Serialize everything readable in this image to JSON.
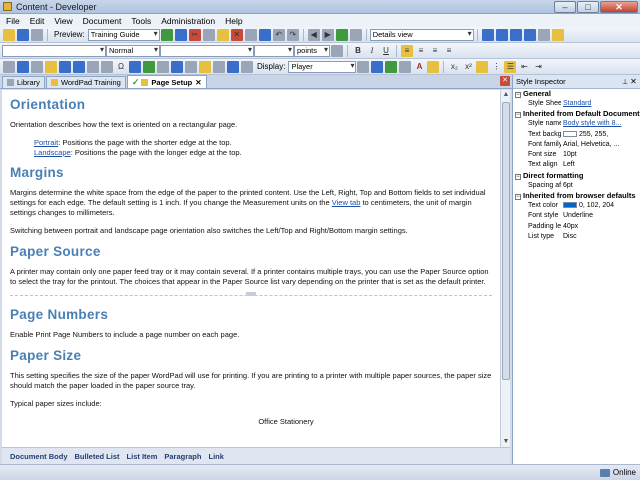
{
  "window": {
    "title": "Content - Developer"
  },
  "menu": [
    "File",
    "Edit",
    "View",
    "Document",
    "Tools",
    "Administration",
    "Help"
  ],
  "toolbar": {
    "preview_label": "Preview:",
    "preview_value": "Training Guide",
    "view_value": "Details view",
    "style_value": "Normal",
    "size_unit": "points",
    "display_label": "Display:",
    "display_value": "Player"
  },
  "tabs": [
    {
      "label": "Library",
      "active": false
    },
    {
      "label": "WordPad Training",
      "active": false
    },
    {
      "label": "Page Setup",
      "active": true
    }
  ],
  "document": {
    "orientation": {
      "heading": "Orientation",
      "intro": "Orientation describes how the text is oriented on a rectangular page.",
      "portrait_link": "Portrait",
      "portrait_text": ": Positions the page with the shorter edge at the top.",
      "landscape_link": "Landscape",
      "landscape_text": ": Positions the page with the longer edge at the top."
    },
    "margins": {
      "heading": "Margins",
      "p1_before": "Margins determine the white space from the edge of the paper to the printed content. Use the Left, Right, Top and Bottom fields to set individual settings for each edge. The default setting is 1 inch. If you change the Measurement units on the ",
      "p1_link": "View tab",
      "p1_after": " to centimeters, the unit of margin settings changes to millimeters.",
      "p2": "Switching between portrait and landscape page orientation also switches the Left/Top and Right/Bottom margin settings."
    },
    "paper_source": {
      "heading": "Paper Source",
      "p1": "A printer may contain only one paper feed tray or it may contain several. If a printer contains multiple trays, you can use the Paper Source option to select the tray for the printout. The choices that appear in the Paper Source list vary depending on the printer that is set as the default printer."
    },
    "page_numbers": {
      "heading": "Page Numbers",
      "p1": "Enable Print Page Numbers to include a page number on each page."
    },
    "paper_size": {
      "heading": "Paper Size",
      "p1": "This setting specifies the size of the paper WordPad will use for printing. If you are printing to a printer with multiple paper sources, the paper size should match the paper loaded in the paper source tray.",
      "p2": "Typical paper sizes include:",
      "cut_line": "Office Stationery"
    }
  },
  "tag_bar": [
    "Document Body",
    "Bulleted List",
    "List Item",
    "Paragraph",
    "Link"
  ],
  "inspector": {
    "title": "Style Inspector",
    "groups": [
      {
        "name": "General",
        "rows": [
          {
            "k": "Style Sheet",
            "v": "Standard",
            "link": true
          }
        ]
      },
      {
        "name": "Inherited from Default Document",
        "rows": [
          {
            "k": "Style name",
            "v": "Body style with 8...",
            "link": true
          },
          {
            "k": "Text backgrou",
            "v": "255, 255,",
            "swatch": "#ffffff"
          },
          {
            "k": "Font family",
            "v": "Arial, Helvetica, ..."
          },
          {
            "k": "Font size",
            "v": "10pt"
          },
          {
            "k": "Text align",
            "v": "Left"
          }
        ]
      },
      {
        "name": "Direct formatting",
        "rows": [
          {
            "k": "Spacing after",
            "v": "6pt"
          }
        ]
      },
      {
        "name": "Inherited from browser defaults",
        "rows": [
          {
            "k": "Text color",
            "v": "0, 102, 204",
            "swatch": "#0066cc"
          },
          {
            "k": "Font style",
            "v": "Underline"
          },
          {
            "k": "Padding left",
            "v": "40px"
          },
          {
            "k": "List type",
            "v": "Disc"
          }
        ]
      }
    ]
  },
  "status": {
    "text": "Online"
  },
  "colors": {
    "heading": "#4a7fb5",
    "link": "#1d4ea8",
    "chrome": "#d4dbe8"
  }
}
